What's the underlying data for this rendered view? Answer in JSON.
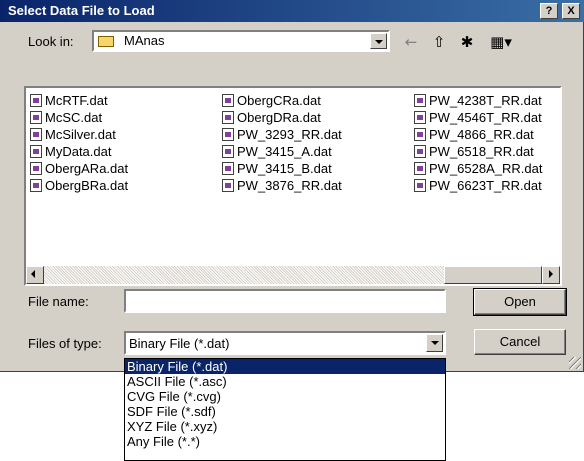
{
  "window": {
    "title": "Select Data File to Load",
    "help_label": "?",
    "close_label": "X"
  },
  "lookin": {
    "label": "Look in:",
    "value": "MAnas"
  },
  "files": {
    "col1": [
      "McRTF.dat",
      "McSC.dat",
      "McSilver.dat",
      "MyData.dat",
      "ObergARa.dat",
      "ObergBRa.dat"
    ],
    "col2": [
      "ObergCRa.dat",
      "ObergDRa.dat",
      "PW_3293_RR.dat",
      "PW_3415_A.dat",
      "PW_3415_B.dat",
      "PW_3876_RR.dat"
    ],
    "col3": [
      "PW_4238T_RR.dat",
      "PW_4546T_RR.dat",
      "PW_4866_RR.dat",
      "PW_6518_RR.dat",
      "PW_6528A_RR.dat",
      "PW_6623T_RR.dat"
    ]
  },
  "filename": {
    "label": "File name:",
    "value": ""
  },
  "filetype": {
    "label": "Files of type:",
    "value": "Binary File (*.dat)",
    "options": [
      "Binary File (*.dat)",
      "ASCII File (*.asc)",
      "CVG File (*.cvg)",
      "SDF File (*.sdf)",
      "XYZ File (*.xyz)",
      "Any File (*.*)"
    ]
  },
  "buttons": {
    "open": "Open",
    "cancel": "Cancel"
  }
}
